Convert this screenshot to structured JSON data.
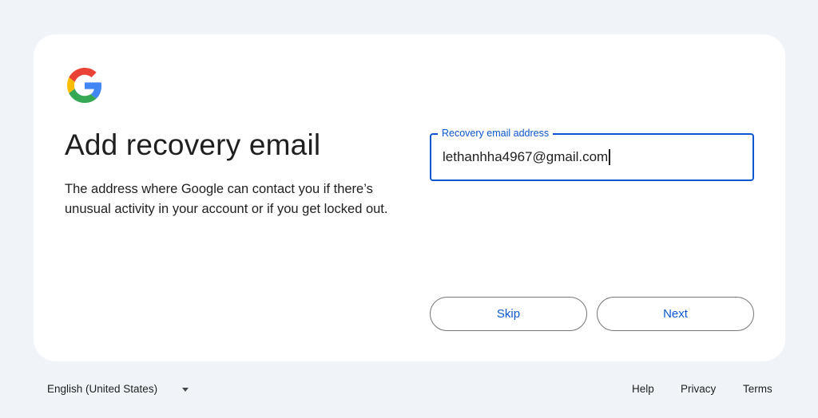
{
  "brand": {
    "logo_icon": "google-g-logo-icon",
    "colors": {
      "blue": "#4285F4",
      "red": "#EA4335",
      "yellow": "#FBBC05",
      "green": "#34A853",
      "accent": "#0b57d0"
    }
  },
  "page": {
    "title": "Add recovery email",
    "description": "The address where Google can contact you if there’s unusual activity in your account or if you get locked out."
  },
  "recovery_email": {
    "label": "Recovery email address",
    "value": "lethanhha4967@gmail.com"
  },
  "actions": {
    "skip_label": "Skip",
    "next_label": "Next"
  },
  "footer": {
    "language": "English (United States)",
    "language_icon": "dropdown-arrow-icon",
    "help": "Help",
    "privacy": "Privacy",
    "terms": "Terms"
  }
}
